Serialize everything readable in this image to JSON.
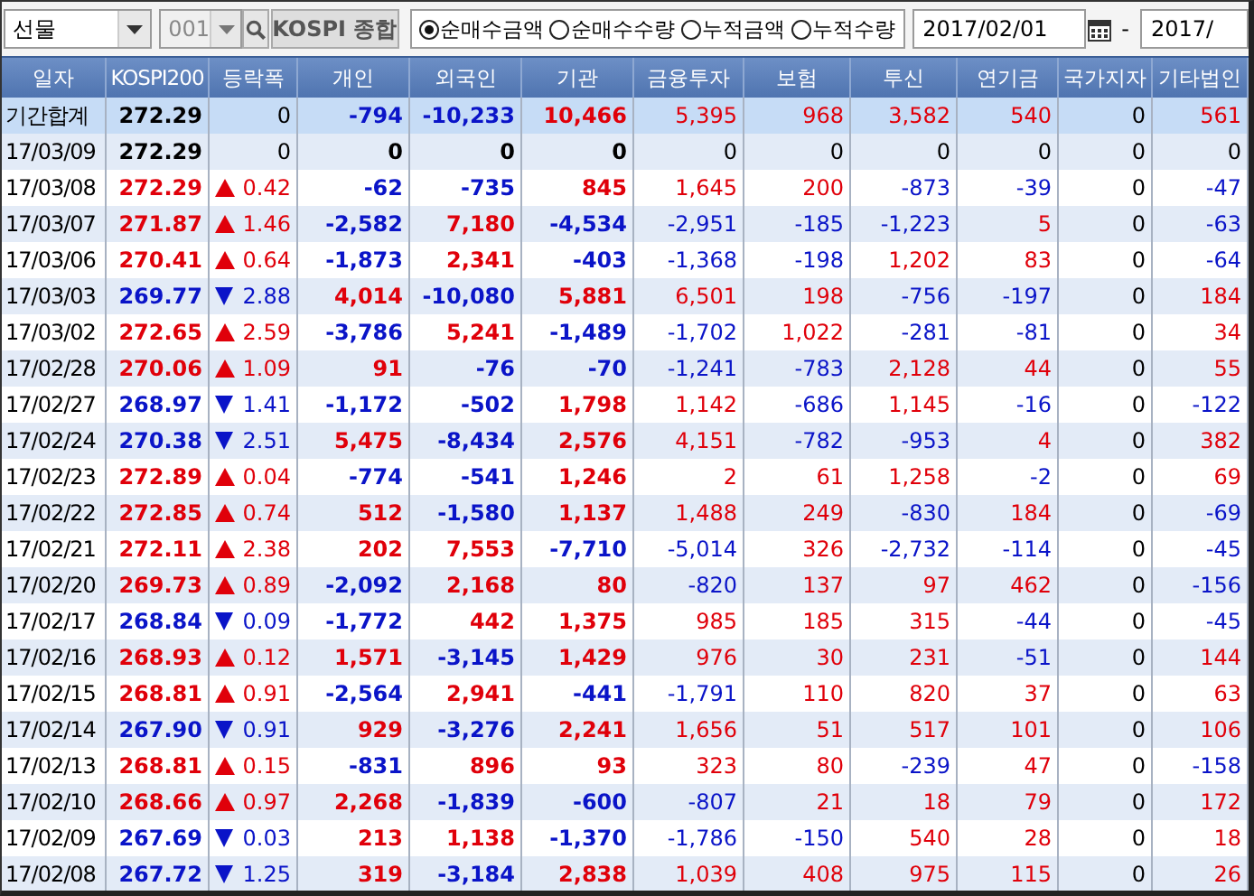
{
  "toolbar": {
    "market_select": {
      "value": "선물"
    },
    "code_field": {
      "value": "001",
      "disabled": true
    },
    "index_button": {
      "label": "KOSPI 종합"
    },
    "radios": [
      {
        "label": "순매수금액",
        "selected": true
      },
      {
        "label": "순매수수량",
        "selected": false
      },
      {
        "label": "누적금액",
        "selected": false
      },
      {
        "label": "누적수량",
        "selected": false
      }
    ],
    "date_from": {
      "value": "2017/02/01"
    },
    "date_separator": "-",
    "date_to": {
      "value": "2017/"
    }
  },
  "table": {
    "columns": [
      "일자",
      "KOSPI200",
      "등락폭",
      "개인",
      "외국인",
      "기관",
      "금융투자",
      "보험",
      "투신",
      "연기금",
      "국가지자",
      "기타법인"
    ],
    "rows": [
      {
        "kind": "summary",
        "date": "기간합계",
        "kospi": "272.29",
        "rising": false,
        "falling": false,
        "change": "0",
        "values": [
          "-794",
          "-10,233",
          "10,466",
          "5,395",
          "968",
          "3,582",
          "540",
          "0",
          "561"
        ]
      },
      {
        "kind": "day",
        "date": "17/03/09",
        "kospi": "272.29",
        "rising": false,
        "falling": false,
        "change": "0",
        "values": [
          "0",
          "0",
          "0",
          "0",
          "0",
          "0",
          "0",
          "0",
          "0"
        ]
      },
      {
        "kind": "day",
        "date": "17/03/08",
        "kospi": "272.29",
        "rising": true,
        "falling": false,
        "change": "0.42",
        "values": [
          "-62",
          "-735",
          "845",
          "1,645",
          "200",
          "-873",
          "-39",
          "0",
          "-47"
        ]
      },
      {
        "kind": "day",
        "date": "17/03/07",
        "kospi": "271.87",
        "rising": true,
        "falling": false,
        "change": "1.46",
        "values": [
          "-2,582",
          "7,180",
          "-4,534",
          "-2,951",
          "-185",
          "-1,223",
          "5",
          "0",
          "-63"
        ]
      },
      {
        "kind": "day",
        "date": "17/03/06",
        "kospi": "270.41",
        "rising": true,
        "falling": false,
        "change": "0.64",
        "values": [
          "-1,873",
          "2,341",
          "-403",
          "-1,368",
          "-198",
          "1,202",
          "83",
          "0",
          "-64"
        ]
      },
      {
        "kind": "day",
        "date": "17/03/03",
        "kospi": "269.77",
        "rising": false,
        "falling": true,
        "change": "2.88",
        "values": [
          "4,014",
          "-10,080",
          "5,881",
          "6,501",
          "198",
          "-756",
          "-197",
          "0",
          "184"
        ]
      },
      {
        "kind": "day",
        "date": "17/03/02",
        "kospi": "272.65",
        "rising": true,
        "falling": false,
        "change": "2.59",
        "values": [
          "-3,786",
          "5,241",
          "-1,489",
          "-1,702",
          "1,022",
          "-281",
          "-81",
          "0",
          "34"
        ]
      },
      {
        "kind": "day",
        "date": "17/02/28",
        "kospi": "270.06",
        "rising": true,
        "falling": false,
        "change": "1.09",
        "values": [
          "91",
          "-76",
          "-70",
          "-1,241",
          "-783",
          "2,128",
          "44",
          "0",
          "55"
        ]
      },
      {
        "kind": "day",
        "date": "17/02/27",
        "kospi": "268.97",
        "rising": false,
        "falling": true,
        "change": "1.41",
        "values": [
          "-1,172",
          "-502",
          "1,798",
          "1,142",
          "-686",
          "1,145",
          "-16",
          "0",
          "-122"
        ]
      },
      {
        "kind": "day",
        "date": "17/02/24",
        "kospi": "270.38",
        "rising": false,
        "falling": true,
        "change": "2.51",
        "values": [
          "5,475",
          "-8,434",
          "2,576",
          "4,151",
          "-782",
          "-953",
          "4",
          "0",
          "382"
        ]
      },
      {
        "kind": "day",
        "date": "17/02/23",
        "kospi": "272.89",
        "rising": true,
        "falling": false,
        "change": "0.04",
        "values": [
          "-774",
          "-541",
          "1,246",
          "2",
          "61",
          "1,258",
          "-2",
          "0",
          "69"
        ]
      },
      {
        "kind": "day",
        "date": "17/02/22",
        "kospi": "272.85",
        "rising": true,
        "falling": false,
        "change": "0.74",
        "values": [
          "512",
          "-1,580",
          "1,137",
          "1,488",
          "249",
          "-830",
          "184",
          "0",
          "-69"
        ]
      },
      {
        "kind": "day",
        "date": "17/02/21",
        "kospi": "272.11",
        "rising": true,
        "falling": false,
        "change": "2.38",
        "values": [
          "202",
          "7,553",
          "-7,710",
          "-5,014",
          "326",
          "-2,732",
          "-114",
          "0",
          "-45"
        ]
      },
      {
        "kind": "day",
        "date": "17/02/20",
        "kospi": "269.73",
        "rising": true,
        "falling": false,
        "change": "0.89",
        "values": [
          "-2,092",
          "2,168",
          "80",
          "-820",
          "137",
          "97",
          "462",
          "0",
          "-156"
        ]
      },
      {
        "kind": "day",
        "date": "17/02/17",
        "kospi": "268.84",
        "rising": false,
        "falling": true,
        "change": "0.09",
        "values": [
          "-1,772",
          "442",
          "1,375",
          "985",
          "185",
          "315",
          "-44",
          "0",
          "-45"
        ]
      },
      {
        "kind": "day",
        "date": "17/02/16",
        "kospi": "268.93",
        "rising": true,
        "falling": false,
        "change": "0.12",
        "values": [
          "1,571",
          "-3,145",
          "1,429",
          "976",
          "30",
          "231",
          "-51",
          "0",
          "144"
        ]
      },
      {
        "kind": "day",
        "date": "17/02/15",
        "kospi": "268.81",
        "rising": true,
        "falling": false,
        "change": "0.91",
        "values": [
          "-2,564",
          "2,941",
          "-441",
          "-1,791",
          "110",
          "820",
          "37",
          "0",
          "63"
        ]
      },
      {
        "kind": "day",
        "date": "17/02/14",
        "kospi": "267.90",
        "rising": false,
        "falling": true,
        "change": "0.91",
        "values": [
          "929",
          "-3,276",
          "2,241",
          "1,656",
          "51",
          "517",
          "101",
          "0",
          "106"
        ]
      },
      {
        "kind": "day",
        "date": "17/02/13",
        "kospi": "268.81",
        "rising": true,
        "falling": false,
        "change": "0.15",
        "values": [
          "-831",
          "896",
          "93",
          "323",
          "80",
          "-239",
          "47",
          "0",
          "-158"
        ]
      },
      {
        "kind": "day",
        "date": "17/02/10",
        "kospi": "268.66",
        "rising": true,
        "falling": false,
        "change": "0.97",
        "values": [
          "2,268",
          "-1,839",
          "-600",
          "-807",
          "21",
          "18",
          "79",
          "0",
          "172"
        ]
      },
      {
        "kind": "day",
        "date": "17/02/09",
        "kospi": "267.69",
        "rising": false,
        "falling": true,
        "change": "0.03",
        "values": [
          "213",
          "1,138",
          "-1,370",
          "-1,786",
          "-150",
          "540",
          "28",
          "0",
          "18"
        ]
      },
      {
        "kind": "day",
        "date": "17/02/08",
        "kospi": "267.72",
        "rising": false,
        "falling": true,
        "change": "1.25",
        "values": [
          "319",
          "-3,184",
          "2,838",
          "1,039",
          "408",
          "975",
          "115",
          "0",
          "26"
        ]
      }
    ]
  }
}
